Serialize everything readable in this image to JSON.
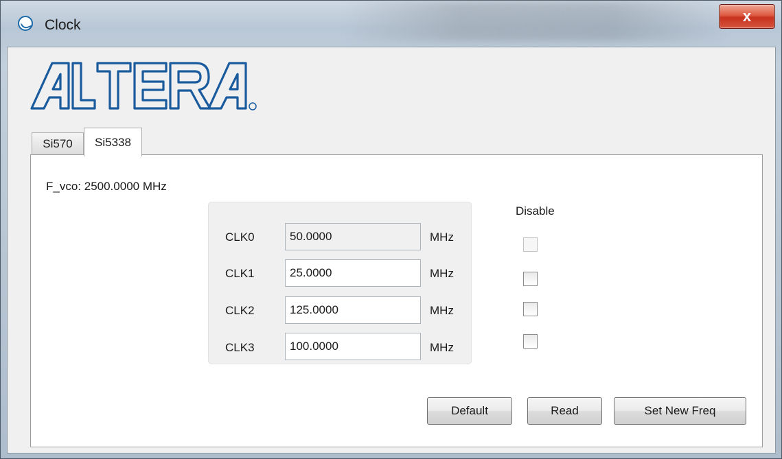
{
  "window": {
    "title": "Clock",
    "close_symbol": "x"
  },
  "logo": {
    "alt": "ALTERA",
    "registered": "®",
    "color": "#1a5b9e"
  },
  "tabs": [
    {
      "label": "Si570",
      "active": false
    },
    {
      "label": "Si5338",
      "active": true
    }
  ],
  "si5338": {
    "fvco": "F_vco: 2500.0000 MHz",
    "disable_header": "Disable",
    "clocks": [
      {
        "label": "CLK0",
        "value": "50.0000",
        "unit": "MHz",
        "editable": false
      },
      {
        "label": "CLK1",
        "value": "25.0000",
        "unit": "MHz",
        "editable": true
      },
      {
        "label": "CLK2",
        "value": "125.0000",
        "unit": "MHz",
        "editable": true
      },
      {
        "label": "CLK3",
        "value": "100.0000",
        "unit": "MHz",
        "editable": true
      }
    ],
    "buttons": {
      "default_label": "Default",
      "read_label": "Read",
      "set_label": "Set New Freq"
    }
  }
}
